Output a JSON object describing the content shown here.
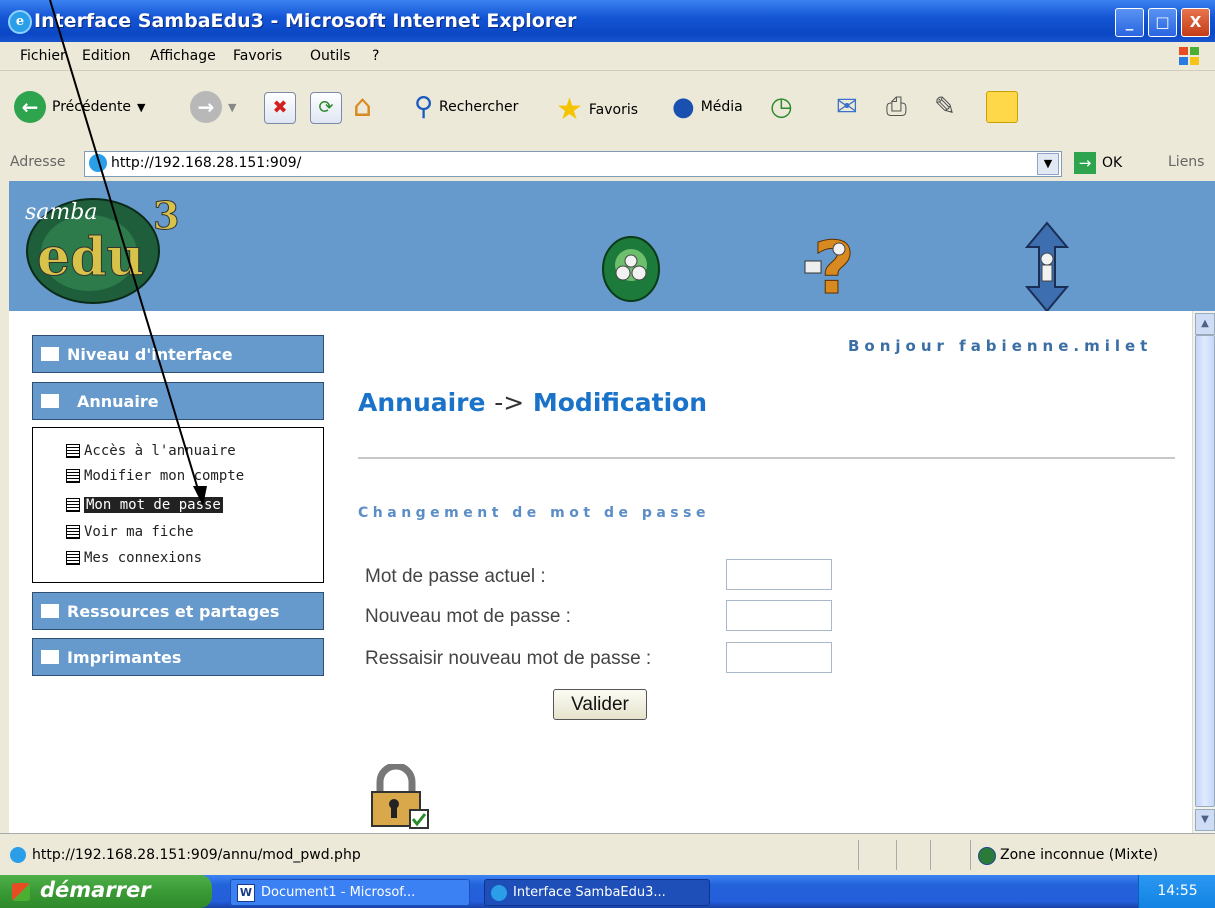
{
  "window": {
    "title": "Interface SambaEdu3 - Microsoft Internet Explorer",
    "controls": {
      "minimize": "_",
      "maximize": "□",
      "close": "X"
    }
  },
  "menubar": [
    "Fichier",
    "Edition",
    "Affichage",
    "Favoris",
    "Outils",
    "?"
  ],
  "toolbar": {
    "back": "Précédente",
    "search": "Rechercher",
    "favorites": "Favoris",
    "media": "Média"
  },
  "addressbar": {
    "label": "Adresse",
    "url": "http://192.168.28.151:909/",
    "go": "OK",
    "links": "Liens"
  },
  "page": {
    "greeting": "Bonjour fabienne.milet",
    "heading_part1": "Annuaire",
    "heading_arrow": "->",
    "heading_part2": "Modification",
    "section_title": "Changement de mot de passe",
    "form": {
      "current_label": "Mot de passe actuel :",
      "new_label": "Nouveau mot de passe :",
      "confirm_label": "Ressaisir nouveau mot de passe :",
      "submit": "Valider"
    }
  },
  "sidebar": {
    "sections": [
      {
        "label": "Niveau d'interface"
      },
      {
        "label": "Annuaire"
      },
      {
        "label": "Ressources et partages"
      },
      {
        "label": "Imprimantes"
      }
    ],
    "annuaire_items": [
      {
        "label": "Accès à l'annuaire"
      },
      {
        "label": "Modifier mon compte"
      },
      {
        "label": "Mon mot de passe",
        "selected": true
      },
      {
        "label": "Voir ma fiche"
      },
      {
        "label": "Mes connexions"
      }
    ]
  },
  "statusbar": {
    "url": "http://192.168.28.151:909/annu/mod_pwd.php",
    "zone": "Zone inconnue (Mixte)"
  },
  "taskbar": {
    "start": "démarrer",
    "tasks": [
      {
        "label": "Document1 - Microsof..."
      },
      {
        "label": "Interface SambaEdu3..."
      }
    ],
    "clock": "14:55"
  },
  "colors": {
    "banner": "#6699cc",
    "heading_blue": "#1a73c8",
    "greeting": "#3a6ea5",
    "sidebar_header": "#6699cc"
  }
}
